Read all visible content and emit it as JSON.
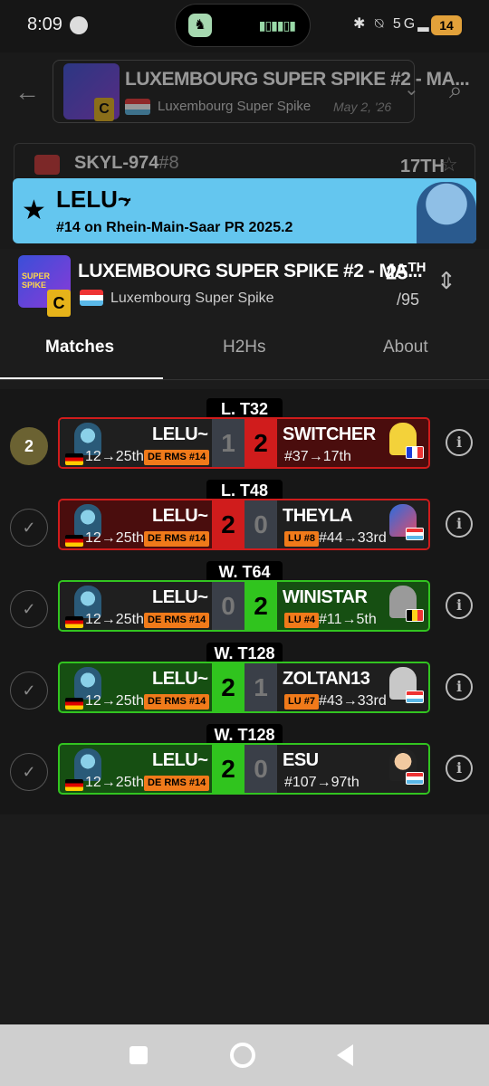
{
  "status_bar": {
    "time": "8:09",
    "network": "5G",
    "battery": "14"
  },
  "background_page": {
    "title": "LUXEMBOURG SUPER SPIKE #2 - MA...",
    "subtitle": "Luxembourg Super Spike",
    "date": "May 2, '26",
    "row_player": "SKYL-974",
    "row_tag": "#8",
    "row_placement": "17TH",
    "logo_tier": "C"
  },
  "player_banner": {
    "name": "LELU~",
    "subtitle": "#14 on Rhein-Main-Saar PR 2025.2"
  },
  "event_header": {
    "title": "LUXEMBOURG SUPER SPIKE #2 - MA...",
    "subtitle": "Luxembourg Super Spike",
    "logo_text": "SUPER SPIKE",
    "tier": "C",
    "placement": "25",
    "placement_suffix": "TH",
    "total_entrants": "/95"
  },
  "tabs": [
    {
      "label": "Matches"
    },
    {
      "label": "H2Hs"
    },
    {
      "label": "About"
    }
  ],
  "matches": [
    {
      "round": "L. T32",
      "left_marker": "2",
      "player": "LELU~",
      "player_seed": "12→25th",
      "player_badge": "DE RMS #14",
      "score_player": "1",
      "score_opponent": "2",
      "opponent": "SWITCHER",
      "opponent_seed": "#37→17th",
      "opponent_badge": ""
    },
    {
      "round": "L. T48",
      "left_marker": "✓",
      "player": "LELU~",
      "player_seed": "12→25th",
      "player_badge": "DE RMS #14",
      "score_player": "2",
      "score_opponent": "0",
      "opponent": "THEYLA",
      "opponent_seed": "#44→33rd",
      "opponent_badge": "LU #8"
    },
    {
      "round": "W. T64",
      "left_marker": "✓",
      "player": "LELU~",
      "player_seed": "12→25th",
      "player_badge": "DE RMS #14",
      "score_player": "0",
      "score_opponent": "2",
      "opponent": "WINISTAR",
      "opponent_seed": "#11→5th",
      "opponent_badge": "LU #4"
    },
    {
      "round": "W. T128",
      "left_marker": "✓",
      "player": "LELU~",
      "player_seed": "12→25th",
      "player_badge": "DE RMS #14",
      "score_player": "2",
      "score_opponent": "1",
      "opponent": "ZOLTAN13",
      "opponent_seed": "#43→33rd",
      "opponent_badge": "LU #7"
    },
    {
      "round": "W. T128",
      "left_marker": "✓",
      "player": "LELU~",
      "player_seed": "12→25th",
      "player_badge": "DE RMS #14",
      "score_player": "2",
      "score_opponent": "0",
      "opponent": "ESU",
      "opponent_seed": "#107→97th",
      "opponent_badge": ""
    }
  ],
  "colors": {
    "loss": "#d01c1c",
    "win": "#30c41e",
    "banner": "#64c6ef",
    "badge": "#f07a1a"
  }
}
